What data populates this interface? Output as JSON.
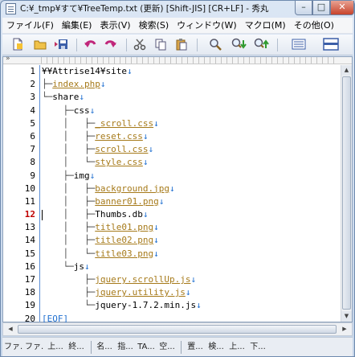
{
  "window": {
    "title": "C:¥_tmp¥すて¥TreeTemp.txt (更新) [Shift-JIS] [CR+LF] - 秀丸",
    "minimize": "–",
    "maximize": "□",
    "close": "✕"
  },
  "menu": [
    "ファイル(F)",
    "編集(E)",
    "表示(V)",
    "検索(S)",
    "ウィンドウ(W)",
    "マクロ(M)",
    "その他(O)"
  ],
  "toolbar": {
    "icons": [
      "new-file-icon",
      "open-folder-icon",
      "save-icon",
      "undo-icon",
      "redo-icon",
      "cut-icon",
      "copy-icon",
      "paste-icon",
      "search-icon",
      "search-down-icon",
      "search-up-icon",
      "list-view-icon",
      "split-window-icon"
    ]
  },
  "editor": {
    "ruler_arrow": "»",
    "current_line": 12,
    "newline_mark": "↓",
    "eof_mark": "[EOF]",
    "lines": [
      {
        "no": "1",
        "tree": "",
        "text": "¥¥Attrise14¥site",
        "link": false
      },
      {
        "no": "2",
        "tree": "├─",
        "text": "index.php",
        "link": true
      },
      {
        "no": "3",
        "tree": "└─",
        "text": "share",
        "link": false
      },
      {
        "no": "4",
        "tree": "    ├─",
        "text": "css",
        "link": false
      },
      {
        "no": "5",
        "tree": "    │   ├─",
        "text": "_scroll.css",
        "link": true
      },
      {
        "no": "6",
        "tree": "    │   ├─",
        "text": "reset.css",
        "link": true
      },
      {
        "no": "7",
        "tree": "    │   ├─",
        "text": "scroll.css",
        "link": true
      },
      {
        "no": "8",
        "tree": "    │   └─",
        "text": "style.css",
        "link": true
      },
      {
        "no": "9",
        "tree": "    ├─",
        "text": "img",
        "link": false
      },
      {
        "no": "10",
        "tree": "    │   ├─",
        "text": "background.jpg",
        "link": true
      },
      {
        "no": "11",
        "tree": "    │   ├─",
        "text": "banner01.png",
        "link": true
      },
      {
        "no": "12",
        "tree": "    │   ├─",
        "text": "Thumbs.db",
        "link": false
      },
      {
        "no": "13",
        "tree": "    │   ├─",
        "text": "title01.png",
        "link": true
      },
      {
        "no": "14",
        "tree": "    │   ├─",
        "text": "title02.png",
        "link": true
      },
      {
        "no": "15",
        "tree": "    │   └─",
        "text": "title03.png",
        "link": true
      },
      {
        "no": "16",
        "tree": "    └─",
        "text": "js",
        "link": false
      },
      {
        "no": "17",
        "tree": "        ├─",
        "text": "jquery.scrollUp.js",
        "link": true
      },
      {
        "no": "18",
        "tree": "        ├─",
        "text": "jquery.utility.js",
        "link": true
      },
      {
        "no": "19",
        "tree": "        └─",
        "text": "jquery-1.7.2.min.js",
        "link": false
      },
      {
        "no": "20",
        "tree": "",
        "text": "",
        "link": false,
        "eof": true
      }
    ]
  },
  "scrollbar": {
    "up": "▲",
    "down": "▼",
    "left": "◀",
    "right": "▶"
  },
  "function_keys": [
    "ファ..",
    "ファ..",
    "上...",
    "終...",
    "名...",
    "指...",
    "TA...",
    "空...",
    "置...",
    "検...",
    "上...",
    "下..."
  ]
}
